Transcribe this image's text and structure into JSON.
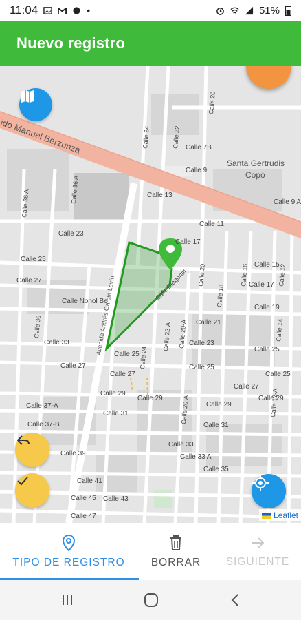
{
  "status_bar": {
    "time": "11:04",
    "battery": "51%"
  },
  "app_bar": {
    "title": "Nuevo registro"
  },
  "map": {
    "labels": {
      "calle_20": "Calle 20",
      "calle_22": "Calle 22",
      "calle_24": "Calle 24",
      "calle_7b": "Calle 7B",
      "calle_9": "Calle 9",
      "santa_gertrudis": "Santa Gertrudis",
      "copo": "Copó",
      "manuel_berzunza": "ido Manuel Berzunza",
      "calle_36a": "Calle 36 A",
      "calle_13": "Calle 13",
      "calle_9a": "Calle 9 A",
      "calle_11": "Calle 11",
      "calle_23": "Calle 23",
      "calle_17": "Calle 17",
      "calle_25": "Calle 25",
      "calle_27": "Calle 27",
      "calle_nohol": "Calle Nohol Be",
      "calle_19": "Calle 19",
      "calle_21": "Calle 21",
      "calle_33": "Calle 33",
      "calle_29": "Calle 29",
      "calle_31": "Calle 31",
      "calle_37a": "Calle 37-A",
      "calle_37b": "Calle 37-B",
      "calle_39": "Calle 39",
      "calle_41": "Calle 41",
      "calle_43": "Calle 43",
      "calle_45": "Calle 45",
      "calle_47": "Calle 47",
      "calle_33a": "Calle 33 A",
      "calle_35": "Calle 35",
      "calle_12a": "Calle 12-A",
      "calle_16": "Calle 16",
      "calle_18": "Calle 18",
      "calle_20a": "Calle 20-A",
      "calle_22a": "Calle 22-A",
      "calle_12": "Calle 12",
      "calle_14": "Calle 14",
      "calle_15": "Calle 15",
      "calle_36": "Calle 36",
      "calle_34": "Calle 34",
      "avenida": "Avenida Andrés García Lavín",
      "diagonal": "Calle Diagonal",
      "leaflet": "Leaflet"
    }
  },
  "bottom_nav": {
    "tipo": "TIPO DE REGISTRO",
    "borrar": "BORRAR",
    "siguiente": "SIGUIENTE"
  },
  "colors": {
    "app_bar": "#3fba3a",
    "close_fab": "#f39540",
    "blue_fab": "#1e98e6",
    "yellow_fab": "#f6c94a",
    "active_tab": "#2f8ee5",
    "polygon": "#1f9a1f"
  },
  "icons": {
    "close": "close-icon",
    "layers": "map-icon",
    "undo": "undo-icon",
    "check": "check-icon",
    "locate": "crosshair-icon",
    "marker": "map-pin-icon",
    "tipo": "location-pin-icon",
    "borrar": "trash-icon",
    "siguiente": "arrow-right-icon"
  }
}
